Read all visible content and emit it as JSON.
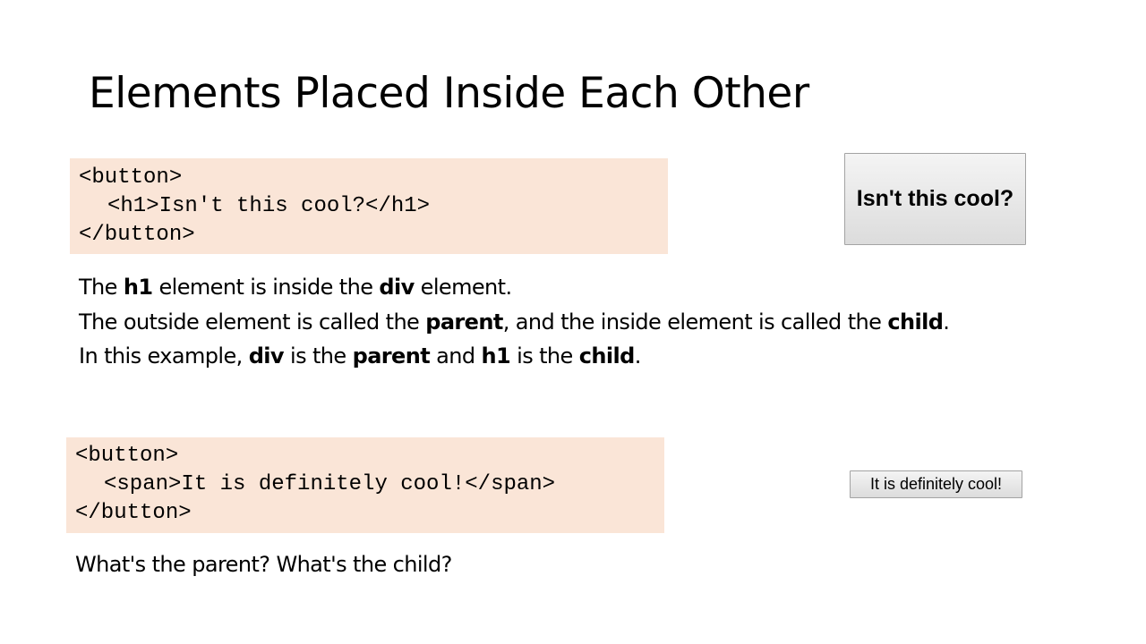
{
  "slide": {
    "title": "Elements Placed Inside Each Other",
    "example1": {
      "code": [
        "<button>",
        "<h1>Isn't this cool?</h1>",
        "</button>"
      ],
      "rendered_button_text": "Isn't this cool?"
    },
    "explanation": {
      "line1": [
        "The ",
        "h1",
        " element is inside the ",
        "div",
        " element."
      ],
      "line2": [
        "The outside element is called the ",
        "parent",
        ", and the inside element is called the ",
        "child",
        "."
      ],
      "line3": [
        "In this example, ",
        "div",
        " is the ",
        "parent",
        " and ",
        "h1",
        " is the ",
        "child",
        "."
      ]
    },
    "example2": {
      "code": [
        "<button>",
        "<span>It is definitely cool!</span>",
        "</button>"
      ],
      "rendered_button_text": "It is definitely cool!"
    },
    "question": "What's the parent? What's the child?"
  },
  "colors": {
    "code_background": "#fae5d7",
    "button_border": "#a3a3a3"
  }
}
